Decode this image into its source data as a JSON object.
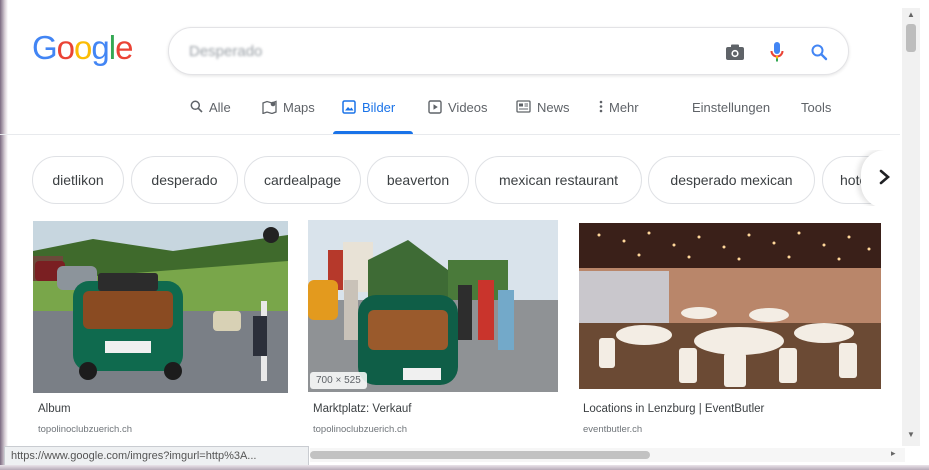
{
  "logo": {
    "letters": [
      "G",
      "o",
      "o",
      "g",
      "l",
      "e"
    ],
    "colors": [
      "#4285F4",
      "#EA4335",
      "#FBBC05",
      "#4285F4",
      "#34A853",
      "#EA4335"
    ]
  },
  "search": {
    "query": "Desperado"
  },
  "tabs": [
    {
      "label": "Alle",
      "icon": "search-icon"
    },
    {
      "label": "Maps",
      "icon": "maps-icon"
    },
    {
      "label": "Bilder",
      "icon": "image-icon",
      "active": true
    },
    {
      "label": "Videos",
      "icon": "play-icon"
    },
    {
      "label": "News",
      "icon": "newspaper-icon"
    },
    {
      "label": "Mehr",
      "icon": "more-vertical-icon"
    }
  ],
  "tools": {
    "settings": "Einstellungen",
    "tools": "Tools"
  },
  "chips": [
    "dietlikon",
    "desperado",
    "cardealpage",
    "beaverton",
    "mexican restaurant",
    "desperado mexican",
    "hote"
  ],
  "results": [
    {
      "title": "Album",
      "source": "topolinoclubzuerich.ch"
    },
    {
      "title": "Marktplatz: Verkauf",
      "source": "topolinoclubzuerich.ch",
      "dimensions": "700 × 525"
    },
    {
      "title": "Locations in Lenzburg | EventButler",
      "source": "eventbutler.ch"
    }
  ],
  "status": {
    "url": "https://www.google.com/imgres?imgurl=http%3A..."
  },
  "colors": {
    "accent": "#1a73e8",
    "mic_red": "#EA4335",
    "icon_gray": "#5f6368"
  }
}
